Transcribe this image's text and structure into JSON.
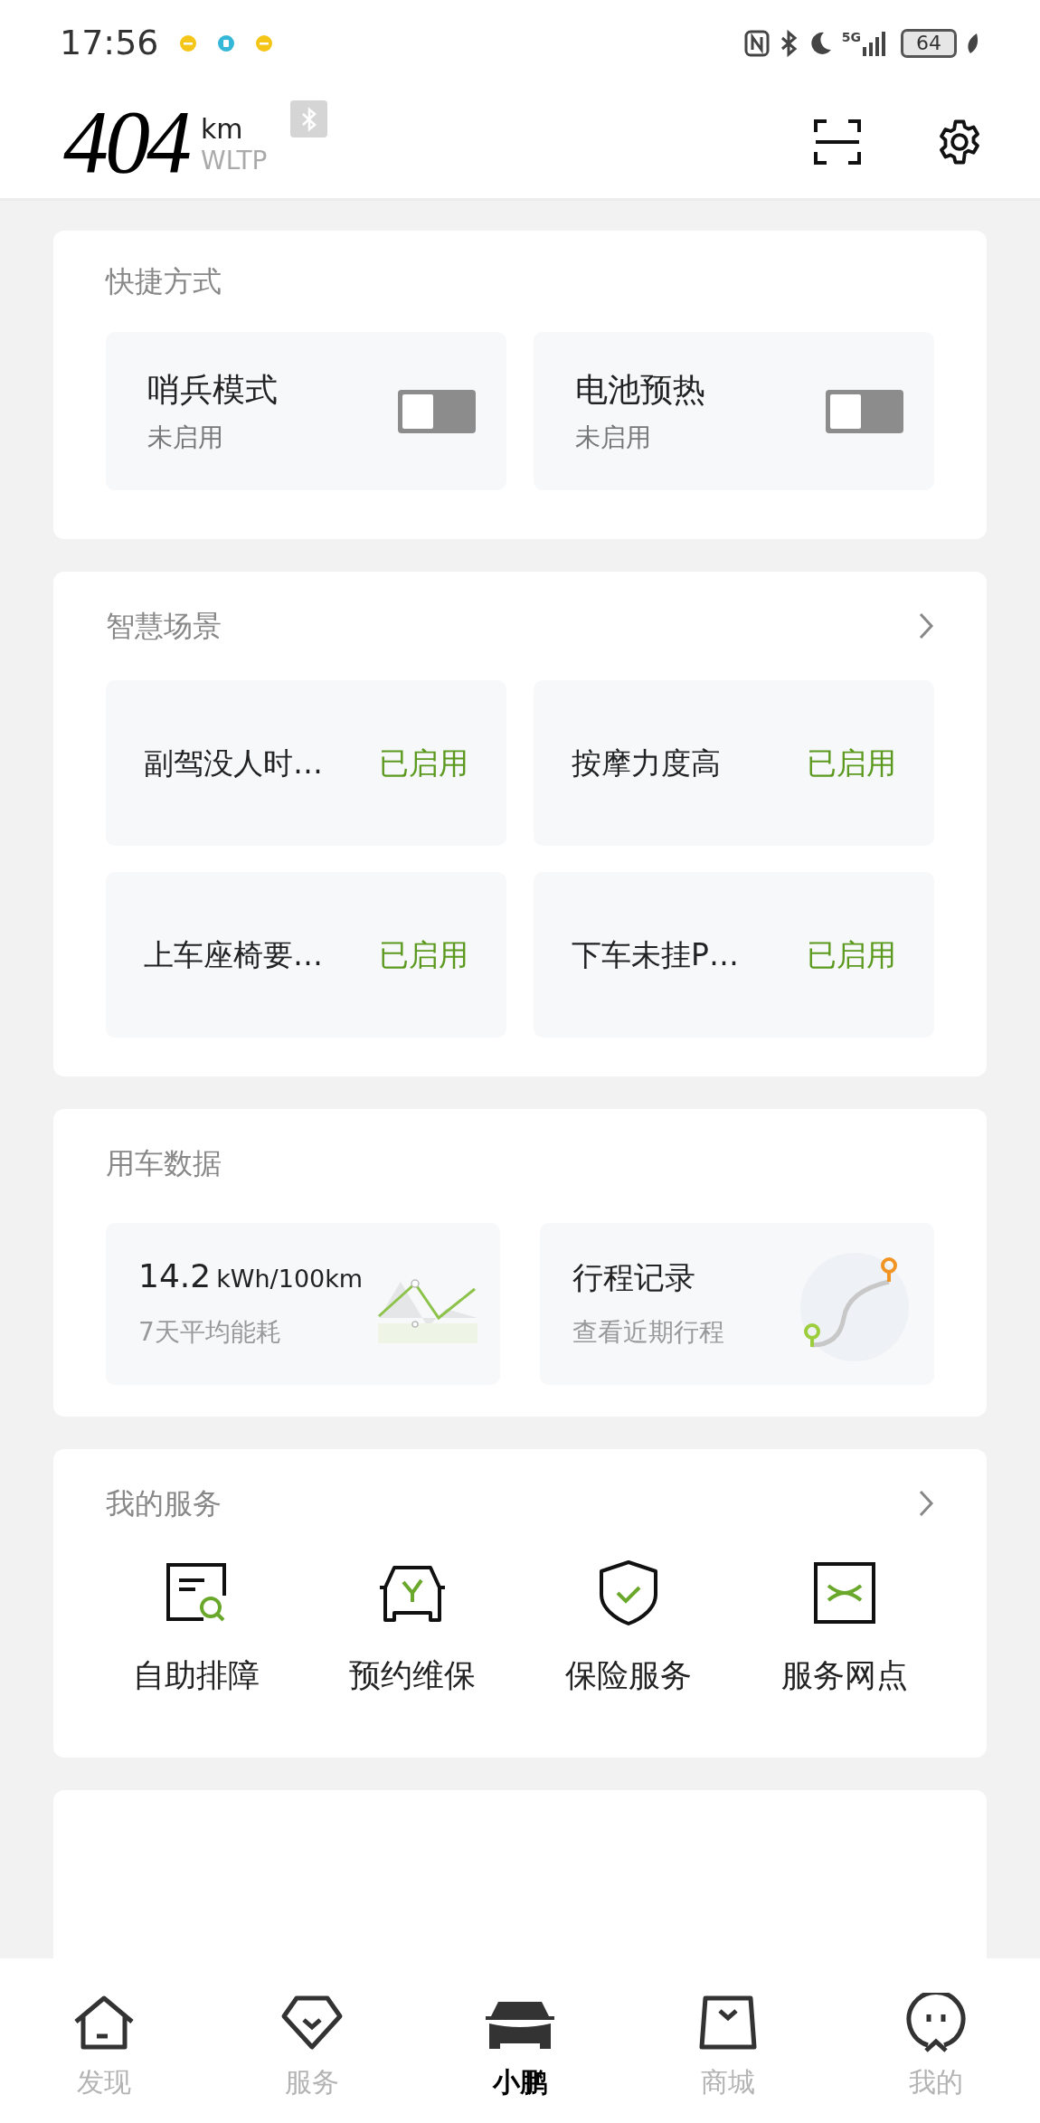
{
  "status_bar": {
    "time": "17:56",
    "network": "5G",
    "battery": "64"
  },
  "header": {
    "range": "404",
    "unit": "km",
    "standard": "WLTP"
  },
  "shortcuts": {
    "title": "快捷方式",
    "items": [
      {
        "name": "哨兵模式",
        "state_text": "未启用",
        "on": false
      },
      {
        "name": "电池预热",
        "state_text": "未启用",
        "on": false
      }
    ]
  },
  "scenes": {
    "title": "智慧场景",
    "items": [
      {
        "name": "副驾没人时…",
        "status": "已启用",
        "enabled": true
      },
      {
        "name": "按摩力度高",
        "status": "已启用",
        "enabled": true
      },
      {
        "name": "上车座椅要…",
        "status": "已启用",
        "enabled": true
      },
      {
        "name": "下车未挂P…",
        "status": "已启用",
        "enabled": true
      }
    ]
  },
  "vehicle_data": {
    "title": "用车数据",
    "items": [
      {
        "kind": "energy",
        "value": "14.2",
        "unit": "kWh/100km",
        "caption": "7天平均能耗"
      },
      {
        "kind": "trips",
        "value": "行程记录",
        "caption": "查看近期行程"
      }
    ]
  },
  "services": {
    "title": "我的服务",
    "items": [
      {
        "kind": "diagnose",
        "label": "自助排障"
      },
      {
        "kind": "maintenance",
        "label": "预约维保"
      },
      {
        "kind": "insurance",
        "label": "保险服务"
      },
      {
        "kind": "outlets",
        "label": "服务网点"
      }
    ]
  },
  "tab_bar": [
    {
      "kind": "home",
      "label": "发现",
      "selected": false
    },
    {
      "kind": "service",
      "label": "服务",
      "selected": false
    },
    {
      "kind": "car",
      "label": "小鹏",
      "selected": true
    },
    {
      "kind": "shop",
      "label": "商城",
      "selected": false
    },
    {
      "kind": "me",
      "label": "我的",
      "selected": false
    }
  ]
}
